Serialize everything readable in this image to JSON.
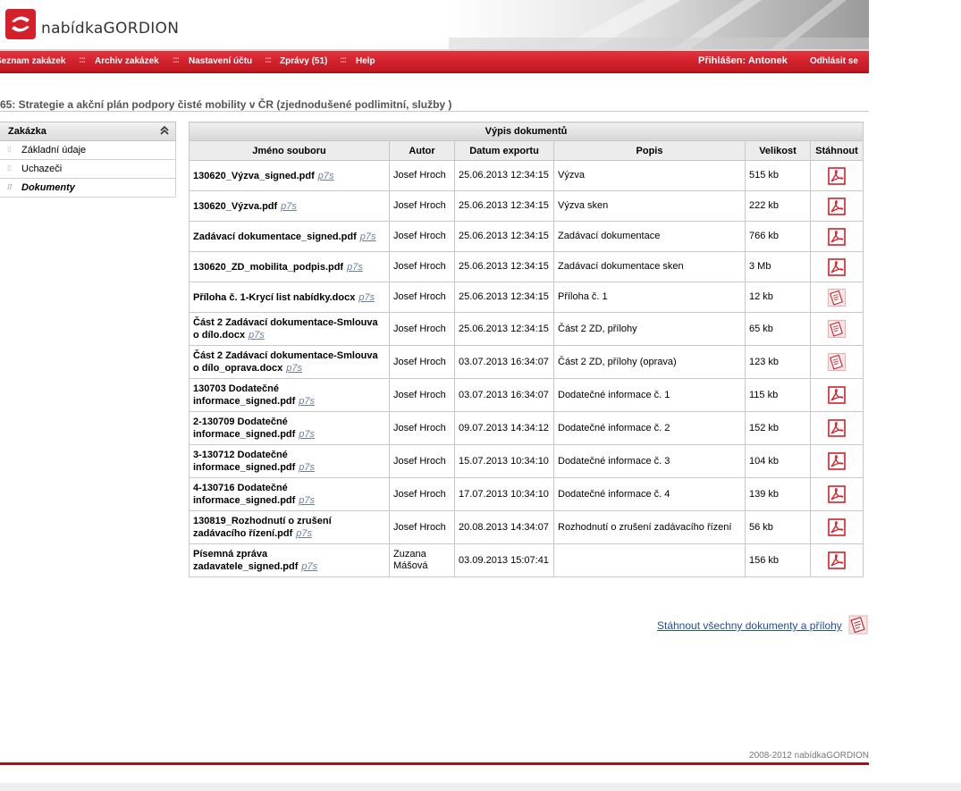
{
  "brand": {
    "name": "nabídkaGORDION"
  },
  "nav": {
    "items": [
      "Seznam zakázek",
      "Archiv zakázek",
      "Nastavení účtu",
      "Zprávy (51)",
      "Help"
    ],
    "separator": ":::",
    "login_label": "Přihlášen: Antonek",
    "logout": "Odhlásit se"
  },
  "page": {
    "title": "65: Strategie a akční plán podpory čisté mobility v ČR (zjednodušené podlimitní, služby )"
  },
  "sidebar": {
    "heading": "Zakázka",
    "collapse_icon": "double-chevron-up-icon",
    "items": [
      {
        "label": "Základní údaje",
        "active": false
      },
      {
        "label": "Uchazeči",
        "active": false
      },
      {
        "label": "Dokumenty",
        "active": true
      }
    ]
  },
  "table": {
    "caption": "Výpis dokumentů",
    "columns": [
      "Jméno souboru",
      "Autor",
      "Datum exportu",
      "Popis",
      "Velikost",
      "Stáhnout"
    ],
    "p7s_label": "p7s",
    "rows": [
      {
        "name": "130620_Výzva_signed.pdf",
        "author": "Josef Hroch",
        "date": "25.06.2013 12:34:15",
        "desc": "Výzva",
        "size": "515 kb",
        "icon": "pdf-icon"
      },
      {
        "name": "130620_Výzva.pdf",
        "author": "Josef Hroch",
        "date": "25.06.2013 12:34:15",
        "desc": "Výzva sken",
        "size": "222 kb",
        "icon": "pdf-icon"
      },
      {
        "name": "Zadávací dokumentace_signed.pdf",
        "author": "Josef Hroch",
        "date": "25.06.2013 12:34:15",
        "desc": "Zadávací dokumentace",
        "size": "766 kb",
        "icon": "pdf-icon"
      },
      {
        "name": "130620_ZD_mobilita_podpis.pdf",
        "author": "Josef Hroch",
        "date": "25.06.2013 12:34:15",
        "desc": "Zadávací dokumentace sken",
        "size": "3 Mb",
        "icon": "pdf-icon"
      },
      {
        "name": "Příloha č. 1-Krycí list nabídky.docx",
        "author": "Josef Hroch",
        "date": "25.06.2013 12:34:15",
        "desc": "Příloha č. 1",
        "size": "12 kb",
        "icon": "document-icon"
      },
      {
        "name": "Část 2 Zadávací dokumentace-Smlouva o dílo.docx",
        "author": "Josef Hroch",
        "date": "25.06.2013 12:34:15",
        "desc": "Část 2 ZD, přílohy",
        "size": "65 kb",
        "icon": "document-icon"
      },
      {
        "name": "Část 2 Zadávací dokumentace-Smlouva o dílo_oprava.docx",
        "author": "Josef Hroch",
        "date": "03.07.2013 16:34:07",
        "desc": "Část 2 ZD, přílohy (oprava)",
        "size": "123 kb",
        "icon": "document-icon"
      },
      {
        "name": "130703 Dodatečné informace_signed.pdf",
        "author": "Josef Hroch",
        "date": "03.07.2013 16:34:07",
        "desc": "Dodatečné informace č. 1",
        "size": "115 kb",
        "icon": "pdf-icon"
      },
      {
        "name": "2-130709 Dodatečné informace_signed.pdf",
        "author": "Josef Hroch",
        "date": "09.07.2013 14:34:12",
        "desc": "Dodatečné informace č. 2",
        "size": "152 kb",
        "icon": "pdf-icon"
      },
      {
        "name": "3-130712 Dodatečné informace_signed.pdf",
        "author": "Josef Hroch",
        "date": "15.07.2013 10:34:10",
        "desc": "Dodatečné informace č. 3",
        "size": "104 kb",
        "icon": "pdf-icon"
      },
      {
        "name": "4-130716 Dodatečné informace_signed.pdf",
        "author": "Josef Hroch",
        "date": "17.07.2013 10:34:10",
        "desc": "Dodatečné informace č. 4",
        "size": "139 kb",
        "icon": "pdf-icon"
      },
      {
        "name": "130819_Rozhodnutí o zrušení zadávacího řízení.pdf",
        "author": "Josef Hroch",
        "date": "20.08.2013 14:34:07",
        "desc": "Rozhodnutí o zrušení zadávacího řízení",
        "size": "56 kb",
        "icon": "pdf-icon"
      },
      {
        "name": "Písemná zpráva zadavatele_signed.pdf",
        "author": "Zuzana Mášová",
        "date": "03.09.2013 15:07:41",
        "desc": "",
        "size": "156 kb",
        "icon": "pdf-icon"
      }
    ]
  },
  "download_all": {
    "label": "Stáhnout všechny dokumenty a přílohy",
    "icon": "document-icon"
  },
  "footer": {
    "copyright": "2008-2012 nabídkaGORDION"
  },
  "colors": {
    "accent": "#d3202b",
    "dark_accent": "#a3141b",
    "link": "#1f4f9b"
  }
}
